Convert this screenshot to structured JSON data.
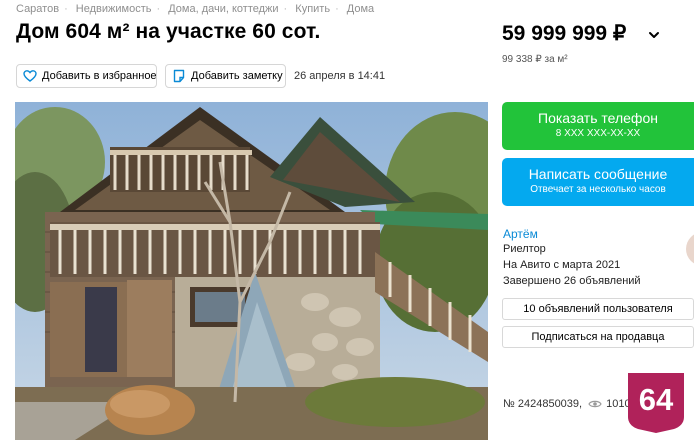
{
  "breadcrumb": [
    "Саратов",
    "Недвижимость",
    "Дома, дачи, коттеджи",
    "Купить",
    "Дома"
  ],
  "listing": {
    "title": "Дом 604 м² на участке 60 сот.",
    "price": "59 999 999 ₽",
    "price_per_unit": "99 338 ₽ за м²",
    "date": "26 апреля в 14:41",
    "id_label": "№ 2424850039,",
    "views": "1010"
  },
  "actions": {
    "favorite_label": "Добавить в избранное",
    "note_label": "Добавить заметку"
  },
  "contact": {
    "show_phone_label": "Показать телефон",
    "phone_masked": "8 XXX XXX-XX-XX",
    "write_message_label": "Написать сообщение",
    "response_note": "Отвечает за несколько часов"
  },
  "seller": {
    "name": "Артём",
    "role": "Риелтор",
    "since": "На Авито с марта 2021",
    "completed": "Завершено 26 объявлений",
    "user_ads_label": "10 объявлений пользователя",
    "subscribe_label": "Подписаться на продавца"
  },
  "watermark": {
    "text": "64"
  },
  "colors": {
    "green": "#22c33a",
    "blue": "#04a9ef",
    "link": "#0a8ad6",
    "badge": "#b0225a"
  },
  "icons": [
    "heart-icon",
    "note-icon",
    "chevron-down-icon",
    "eye-icon"
  ]
}
